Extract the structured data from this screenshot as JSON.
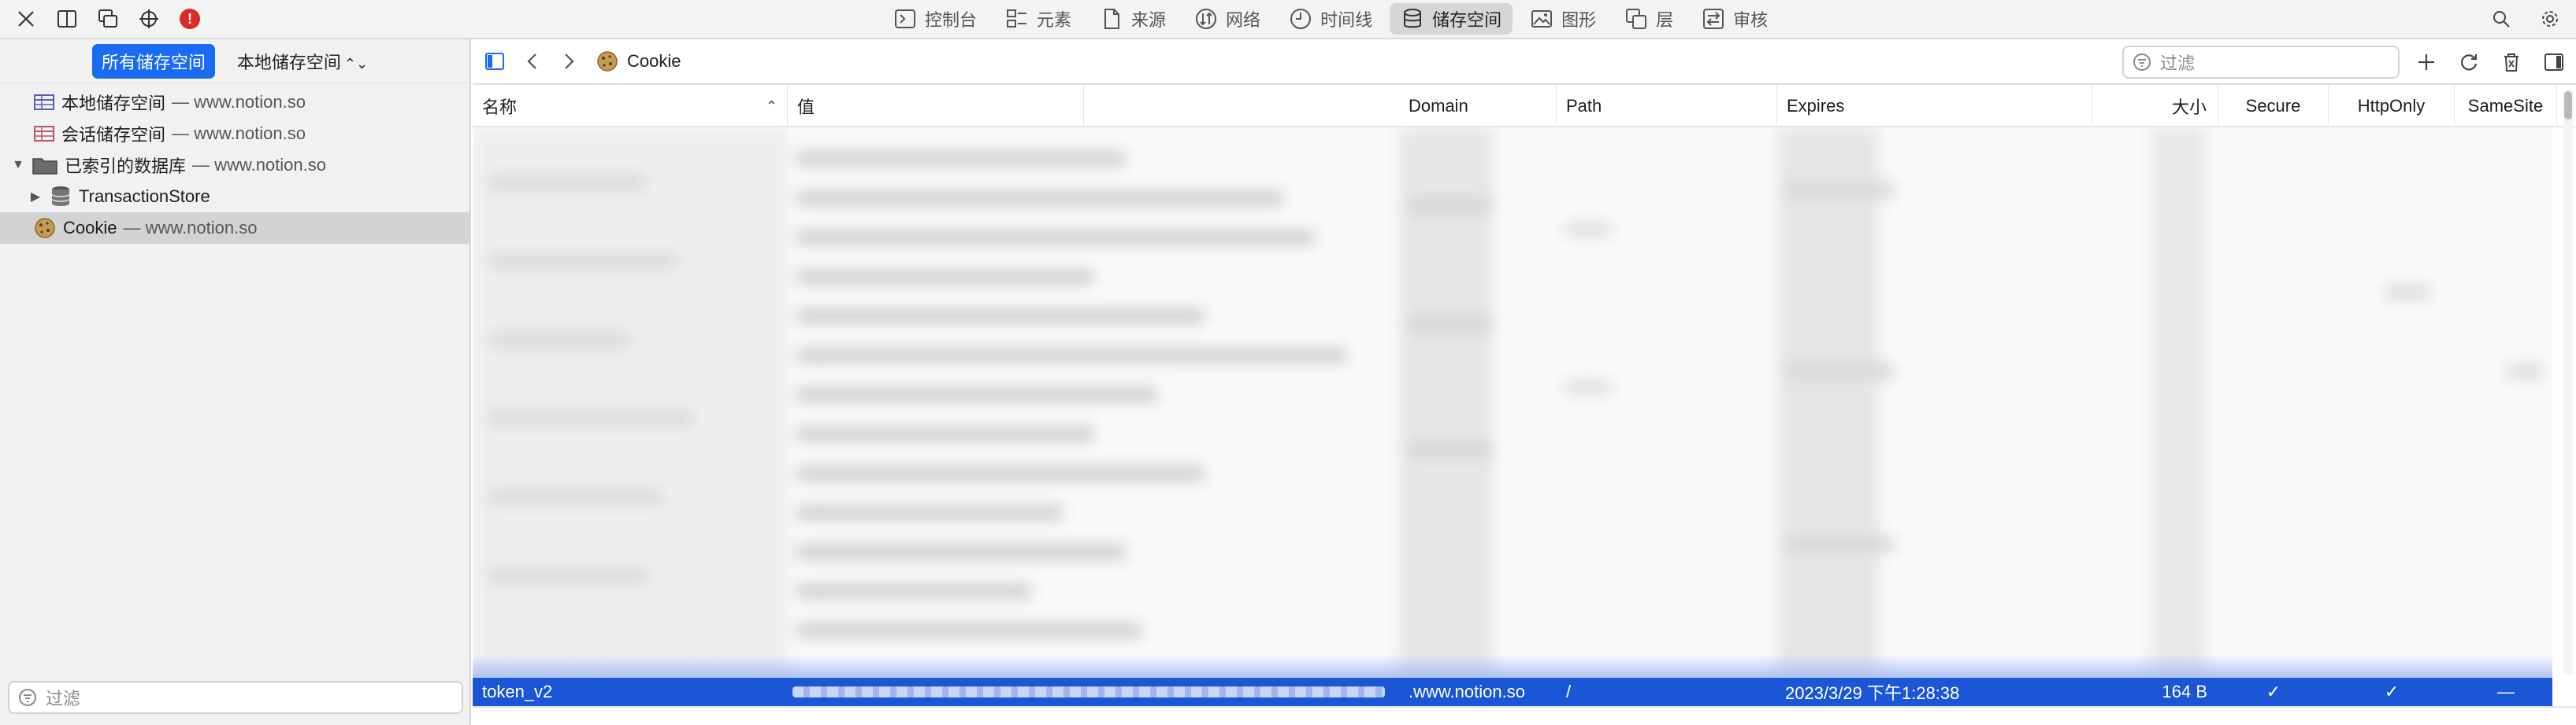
{
  "toolbar": {
    "left_icons": [
      "close-icon",
      "dock-side-icon",
      "detach-window-icon",
      "element-picker-icon",
      "error-badge-icon"
    ],
    "error_badge": "!",
    "tabs": [
      {
        "label": "控制台",
        "icon": "console-icon"
      },
      {
        "label": "元素",
        "icon": "elements-icon"
      },
      {
        "label": "来源",
        "icon": "sources-icon"
      },
      {
        "label": "网络",
        "icon": "network-icon"
      },
      {
        "label": "时间线",
        "icon": "timeline-icon"
      },
      {
        "label": "储存空间",
        "icon": "storage-icon",
        "active": true
      },
      {
        "label": "图形",
        "icon": "graphics-icon"
      },
      {
        "label": "层",
        "icon": "layers-icon"
      },
      {
        "label": "审核",
        "icon": "audit-icon"
      }
    ],
    "right_icons": [
      "search-icon",
      "settings-gear-icon"
    ]
  },
  "sidebar": {
    "scope_all": "所有储存空间",
    "scope_local": "本地储存空间",
    "tree": [
      {
        "label": "本地储存空间",
        "sub": " — www.notion.so",
        "icon": "table-icon",
        "indent": 1
      },
      {
        "label": "会话储存空间",
        "sub": " — www.notion.so",
        "icon": "table-icon",
        "indent": 1
      },
      {
        "label": "已索引的数据库",
        "sub": " — www.notion.so",
        "icon": "folder-icon",
        "indent": 0,
        "expanded": true
      },
      {
        "label": "TransactionStore",
        "sub": "",
        "icon": "database-icon",
        "indent": 1,
        "collapsed": true
      },
      {
        "label": "Cookie",
        "sub": " — www.notion.so",
        "icon": "cookie-icon",
        "indent": 0,
        "selected": true
      }
    ],
    "filter_placeholder": "过滤"
  },
  "main": {
    "title": "Cookie",
    "filter_placeholder": "过滤",
    "columns": [
      "名称",
      "值",
      "Domain",
      "Path",
      "Expires",
      "大小",
      "Secure",
      "HttpOnly",
      "SameSite"
    ],
    "selected_row": {
      "name": "token_v2",
      "value_obscured": true,
      "domain": ".www.notion.so",
      "path": "/",
      "expires": "2023/3/29 下午1:28:38",
      "size": "164 B",
      "secure": "✓",
      "httponly": "✓",
      "samesite": "—"
    }
  },
  "colors": {
    "accent": "#1a6bf3",
    "selection": "#1a56d6",
    "error": "#d92b2b"
  }
}
